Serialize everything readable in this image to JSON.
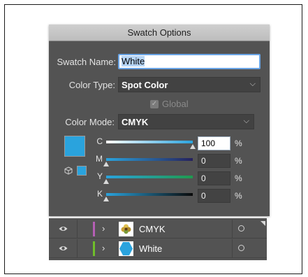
{
  "dialog": {
    "title": "Swatch Options",
    "swatch_name_label": "Swatch Name:",
    "swatch_name_value": "White",
    "color_type_label": "Color Type:",
    "color_type_value": "Spot Color",
    "global_label": "Global",
    "global_checked": true,
    "color_mode_label": "Color Mode:",
    "color_mode_value": "CMYK",
    "swatch_color": "#2aa3dd",
    "channels": [
      {
        "label": "C",
        "value": "100",
        "unit": "%",
        "level": 1.0
      },
      {
        "label": "M",
        "value": "0",
        "unit": "%",
        "level": 0.0
      },
      {
        "label": "Y",
        "value": "0",
        "unit": "%",
        "level": 0.0
      },
      {
        "label": "K",
        "value": "0",
        "unit": "%",
        "level": 0.0
      }
    ]
  },
  "layers": {
    "rows": [
      {
        "name": "CMYK",
        "color": "#b55fb5",
        "thumb": "flower-icon"
      },
      {
        "name": "White",
        "color": "#6fbf2a",
        "thumb": "blue-shape-icon"
      }
    ]
  },
  "colors": {
    "dialog_bg": "#535353",
    "accent": "#6aa5e6",
    "cyan": "#2aa3dd"
  }
}
